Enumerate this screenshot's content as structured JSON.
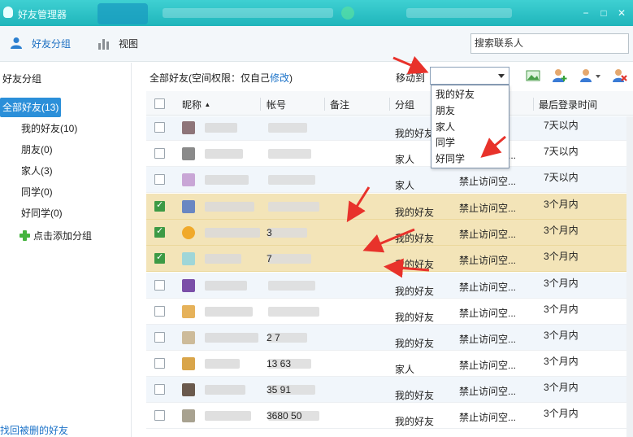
{
  "window": {
    "title": "好友管理器",
    "min": "−",
    "max": "□",
    "close": "✕"
  },
  "toolbar": {
    "friend_groups": "好友分组",
    "view": "视图",
    "search_placeholder": "搜索联系人"
  },
  "sidebar": {
    "title": "好友分组",
    "all": "全部好友(13)",
    "items": [
      "我的好友(10)",
      "朋友(0)",
      "家人(3)",
      "同学(0)",
      "好同学(0)"
    ],
    "add_group": "点击添加分组",
    "recover": "找回被删的好友"
  },
  "main": {
    "breadcrumb_prefix": "全部好友(空间权限：仅自己",
    "breadcrumb_link": "修改",
    "breadcrumb_suffix": ")",
    "move_to": "移动到"
  },
  "table": {
    "headers": {
      "nickname": "昵称",
      "sort_arrow": "▲",
      "account": "帐号",
      "remark": "备注",
      "group": "分组",
      "last_login": "最后登录时间"
    },
    "rows": [
      {
        "checked": false,
        "avatar": "#8e7579",
        "acc": "",
        "grp": "我的好友",
        "perm": "",
        "last": "7天以内",
        "selected": false
      },
      {
        "checked": false,
        "avatar": "#8a8a8a",
        "acc": "",
        "grp": "家人",
        "perm": "禁止访问空...",
        "last": "7天以内",
        "selected": false
      },
      {
        "checked": false,
        "avatar": "#c9a6d6",
        "acc": "",
        "grp": "家人",
        "perm": "禁止访问空...",
        "last": "7天以内",
        "selected": false
      },
      {
        "checked": true,
        "avatar": "#6a87c2",
        "acc": "",
        "grp": "我的好友",
        "perm": "禁止访问空...",
        "last": "3个月内",
        "selected": true
      },
      {
        "checked": true,
        "avatar": "#f0a92a",
        "acc": "3",
        "grp": "我的好友",
        "perm": "禁止访问空...",
        "last": "3个月内",
        "selected": true
      },
      {
        "checked": true,
        "avatar": "#9fd6d8",
        "acc": "7",
        "grp": "我的好友",
        "perm": "禁止访问空...",
        "last": "3个月内",
        "selected": true
      },
      {
        "checked": false,
        "avatar": "#7b4fa8",
        "acc": "",
        "grp": "我的好友",
        "perm": "禁止访问空...",
        "last": "3个月内",
        "selected": false
      },
      {
        "checked": false,
        "avatar": "#e6b25a",
        "acc": "",
        "grp": "我的好友",
        "perm": "禁止访问空...",
        "last": "3个月内",
        "selected": false
      },
      {
        "checked": false,
        "avatar": "#cdbb9a",
        "acc": "2          7",
        "grp": "我的好友",
        "perm": "禁止访问空...",
        "last": "3个月内",
        "selected": false
      },
      {
        "checked": false,
        "avatar": "#d9a54a",
        "acc": "13      63",
        "grp": "家人",
        "perm": "禁止访问空...",
        "last": "3个月内",
        "selected": false
      },
      {
        "checked": false,
        "avatar": "#6b5a4d",
        "acc": "35         91",
        "grp": "我的好友",
        "perm": "禁止访问空...",
        "last": "3个月内",
        "selected": false
      },
      {
        "checked": false,
        "avatar": "#a8a290",
        "acc": "3680      50",
        "grp": "我的好友",
        "perm": "禁止访问空...",
        "last": "3个月内",
        "selected": false
      }
    ]
  },
  "dropdown": {
    "options": [
      "我的好友",
      "朋友",
      "家人",
      "同学",
      "好同学"
    ]
  },
  "colors": {
    "accent": "#2b8fd9",
    "selected_row": "#f3e4b8",
    "titlebar": "#1fb5bb",
    "arrow": "#e8322b"
  }
}
